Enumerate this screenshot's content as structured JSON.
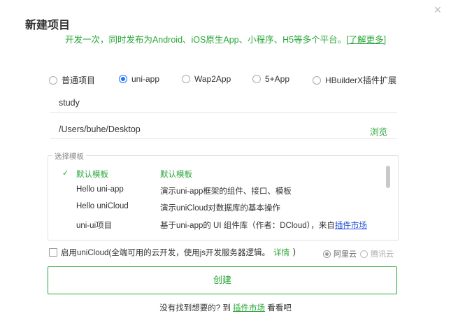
{
  "dialog": {
    "title": "新建项目",
    "close_label": "×"
  },
  "subtitle": {
    "text": "开发一次，同时发布为Android、iOS原生App、小程序、H5等多个平台。",
    "link": "[了解更多]"
  },
  "project_types": [
    {
      "label": "普通项目",
      "checked": false
    },
    {
      "label": "uni-app",
      "checked": true
    },
    {
      "label": "Wap2App",
      "checked": false
    },
    {
      "label": "5+App",
      "checked": false
    },
    {
      "label": "HBuilderX插件扩展",
      "checked": false
    }
  ],
  "project_name": {
    "value": "study"
  },
  "location": {
    "value": "/Users/buhe/Desktop",
    "browse_label": "浏览"
  },
  "templates": {
    "legend": "选择模板",
    "check_mark": "✓",
    "rows": [
      {
        "name": "默认模板",
        "desc": "默认模板",
        "selected": true
      },
      {
        "name": "Hello uni-app",
        "desc": "演示uni-app框架的组件、接口、模板",
        "selected": false
      },
      {
        "name": "Hello uniCloud",
        "desc": "演示uniCloud对数据库的基本操作",
        "selected": false
      },
      {
        "name": "uni-ui项目",
        "desc": "基于uni-app的 UI 组件库（作者：DCloud），来自",
        "link": "插件市场",
        "selected": false
      }
    ]
  },
  "unicloud": {
    "label": "启用uniCloud(全端可用的云开发，使用js开发服务器逻辑。",
    "details_link": "详情",
    "suffix": ")",
    "providers": [
      {
        "label": "阿里云",
        "checked": true
      },
      {
        "label": "腾讯云",
        "checked": false
      }
    ]
  },
  "create_button": {
    "label": "创建"
  },
  "footer": {
    "prefix": "没有找到想要的? 到",
    "link": "插件市场",
    "suffix": "看看吧"
  },
  "colors": {
    "accent": "#2aa63a",
    "radio_selected": "#1e74ff",
    "link_blue": "#1e4fd8"
  }
}
